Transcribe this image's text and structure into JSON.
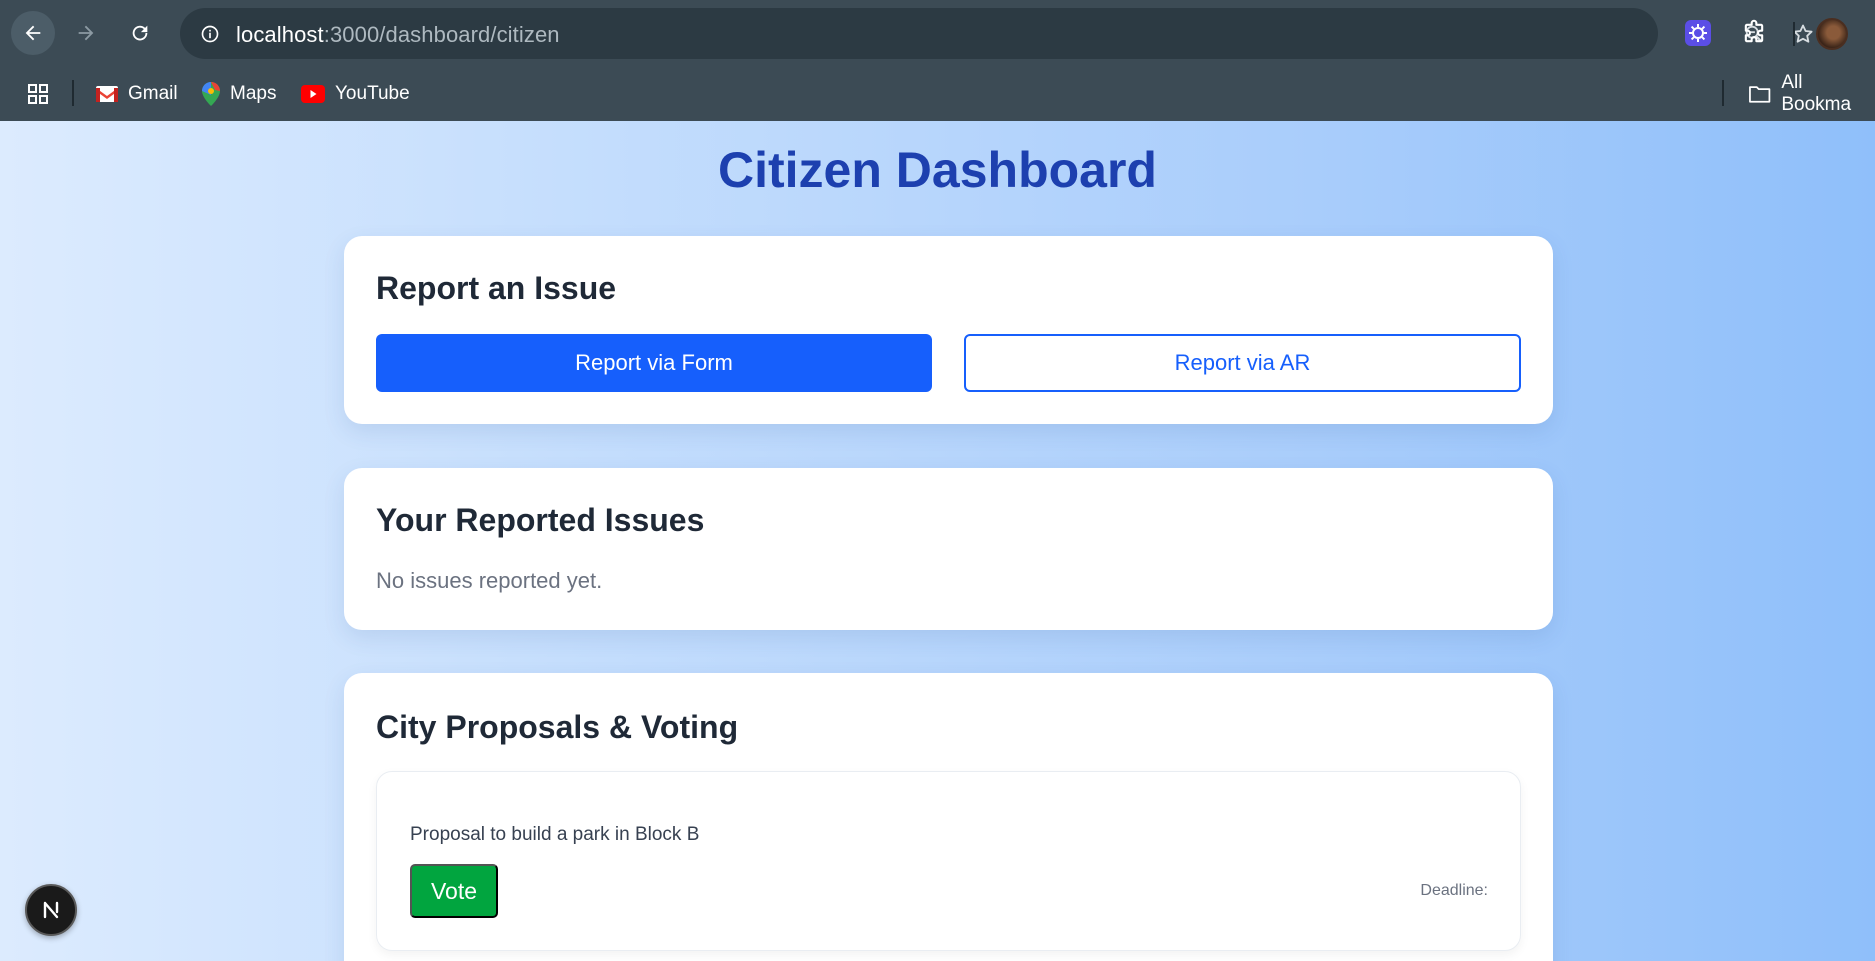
{
  "browser": {
    "url_host": "localhost",
    "url_path": ":3000/dashboard/citizen",
    "bookmarks": [
      {
        "label": "Gmail"
      },
      {
        "label": "Maps"
      },
      {
        "label": "YouTube"
      }
    ],
    "all_bookmarks_label": "All Bookma",
    "icons": [
      "back-icon",
      "forward-icon",
      "reload-icon",
      "site-info-icon",
      "zoom-icon",
      "star-icon",
      "extension-app-icon",
      "extensions-puzzle-icon",
      "profile-avatar",
      "apps-grid-icon",
      "folder-icon"
    ]
  },
  "page": {
    "title": "Citizen Dashboard",
    "report": {
      "heading": "Report an Issue",
      "form_button": "Report via Form",
      "ar_button": "Report via AR"
    },
    "issues": {
      "heading": "Your Reported Issues",
      "empty_text": "No issues reported yet."
    },
    "proposals": {
      "heading": "City Proposals & Voting",
      "items": [
        {
          "title": "Proposal to build a park in Block B",
          "vote_label": "Vote",
          "deadline_label": "Deadline:"
        }
      ]
    },
    "dev_badge": "N"
  },
  "colors": {
    "primary": "#165ffc",
    "title": "#1d40af",
    "vote_green": "#01a53f",
    "chrome": "#3c4b55"
  }
}
